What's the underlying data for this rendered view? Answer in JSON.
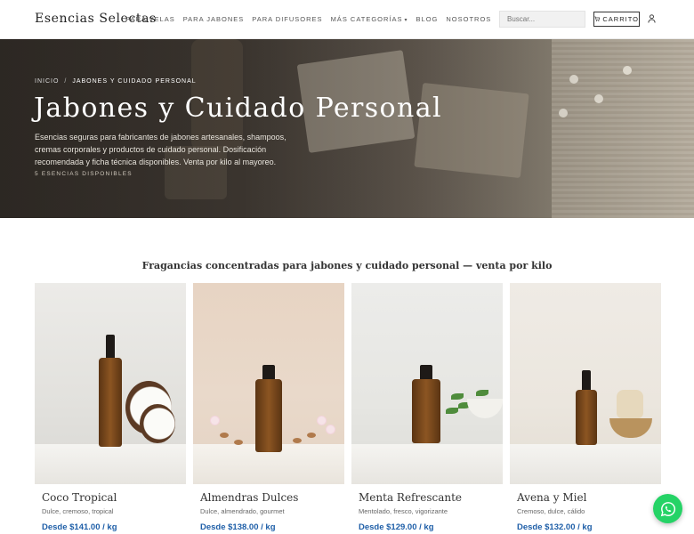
{
  "header": {
    "logo": "Esencias Selectas",
    "nav": [
      {
        "label": "PARA VELAS"
      },
      {
        "label": "PARA JABONES"
      },
      {
        "label": "PARA DIFUSORES"
      },
      {
        "label": "MÁS CATEGORÍAS"
      },
      {
        "label": "BLOG"
      },
      {
        "label": "NOSOTROS"
      }
    ],
    "search_placeholder": "Buscar...",
    "cart_label": "CARRITO"
  },
  "hero": {
    "breadcrumb": {
      "home": "INICIO",
      "separator": "/",
      "current": "JABONES Y CUIDADO PERSONAL"
    },
    "title": "Jabones y Cuidado Personal",
    "description": "Esencias seguras para fabricantes de jabones artesanales, shampoos, cremas corporales y productos de cuidado personal. Dosificación recomendada y ficha técnica disponibles. Venta por kilo al mayoreo.",
    "count": "5 ESENCIAS DISPONIBLES"
  },
  "section": {
    "title": "Fragancias concentradas para jabones y cuidado personal — venta por kilo"
  },
  "products": [
    {
      "name": "Coco Tropical",
      "notes": "Dulce, cremoso, tropical",
      "price": "Desde $141.00 / kg"
    },
    {
      "name": "Almendras Dulces",
      "notes": "Dulce, almendrado, gourmet",
      "price": "Desde $138.00 / kg"
    },
    {
      "name": "Menta Refrescante",
      "notes": "Mentolado, fresco, vigorizante",
      "price": "Desde $129.00 / kg"
    },
    {
      "name": "Avena y Miel",
      "notes": "Cremoso, dulce, cálido",
      "price": "Desde $132.00 / kg"
    }
  ],
  "colors": {
    "price": "#1f5fa8",
    "whatsapp": "#25d366"
  },
  "icons": {
    "cart": "cart-icon",
    "user": "user-icon",
    "whatsapp": "whatsapp-icon"
  }
}
